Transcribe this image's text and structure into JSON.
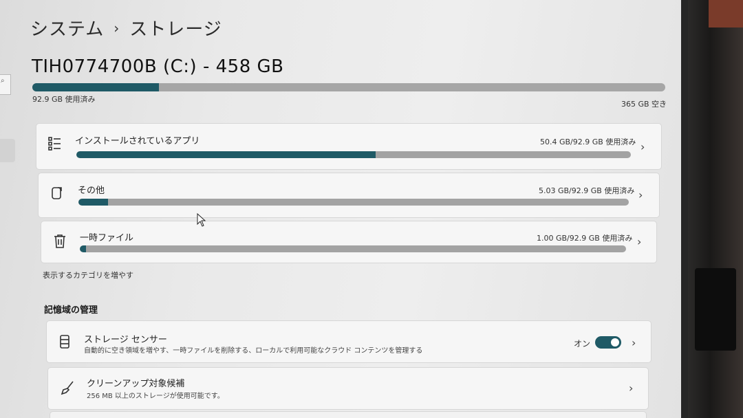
{
  "breadcrumb": {
    "parent": "システム",
    "separator": "›",
    "current": "ストレージ"
  },
  "search": {
    "icon": "search-icon",
    "glyph": "⌕"
  },
  "drive": {
    "title": "TIH0774700B (C:) - 458 GB",
    "used_fraction": 0.2,
    "used_text": "92.9 GB 使用済み",
    "free_text": "365 GB 空き",
    "accent_color": "#1f5a66"
  },
  "categories": [
    {
      "name": "インストールされているアプリ",
      "value": "50.4 GB/92.9 GB 使用済み",
      "fraction": 0.54,
      "icon": "apps-list-icon"
    },
    {
      "name": "その他",
      "value": "5.03 GB/92.9 GB 使用済み",
      "fraction": 0.054,
      "icon": "other-storage-icon"
    },
    {
      "name": "一時ファイル",
      "value": "1.00 GB/92.9 GB 使用済み",
      "fraction": 0.011,
      "icon": "trash-icon"
    }
  ],
  "more_categories": "表示するカテゴリを増やす",
  "storage_management": {
    "title": "記憶域の管理",
    "storage_sense": {
      "title": "ストレージ センサー",
      "description": "自動的に空き領域を増やす、一時ファイルを削除する、ローカルで利用可能なクラウド コンテンツを管理する",
      "toggle_label": "オン",
      "toggle_on": true,
      "icon": "storage-sense-icon"
    },
    "cleanup": {
      "title": "クリーンアップ対象候補",
      "description": "256 MB 以上のストレージが使用可能です。",
      "icon": "broom-icon"
    }
  },
  "chevron": "›"
}
